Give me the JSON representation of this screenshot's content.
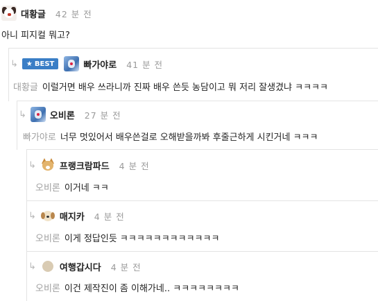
{
  "comments": [
    {
      "name": "대황글",
      "time": "42 분 전",
      "mention": "",
      "text": "아니 피지컬 뭐고?",
      "avatar": "puppy-avatar"
    },
    {
      "name": "빠가야로",
      "time": "41 분 전",
      "mention": "대황글",
      "text": "이럴거면 배우 쓰라니까 진짜 배우 쓴듯 농담이고 뭐 저리 잘생겼냐 ㅋㅋㅋㅋ",
      "badge": "BEST",
      "avatar": "blue-avatar"
    },
    {
      "name": "오비론",
      "time": "27 분 전",
      "mention": "빠가야로",
      "text": "너무 멋있어서 배우쓴걸로 오해받을까봐 후줄근하게 시킨거네 ㅋㅋㅋ",
      "avatar": "blue-avatar"
    },
    {
      "name": "프랭크람파드",
      "time": "4 분 전",
      "mention": "오비론",
      "text": "이거네 ㅋㅋ",
      "avatar": "fox-avatar"
    },
    {
      "name": "매지카",
      "time": "4 분 전",
      "mention": "오비론",
      "text": "이게 정답인듯 ㅋㅋㅋㅋㅋㅋㅋㅋㅋㅋㅋㅋ",
      "avatar": "dog-avatar"
    },
    {
      "name": "여행갑시다",
      "time": "4 분 전",
      "mention": "오비론",
      "text": "이건 제작진이 좀 이해가네.. ㅋㅋㅋㅋㅋㅋㅋㅋ",
      "avatar": "default-avatar"
    }
  ],
  "reply_arrow": "↳",
  "colors": {
    "accent": "#3a7ec6",
    "muted": "#9a9a9a",
    "border": "#e3e3e3"
  }
}
